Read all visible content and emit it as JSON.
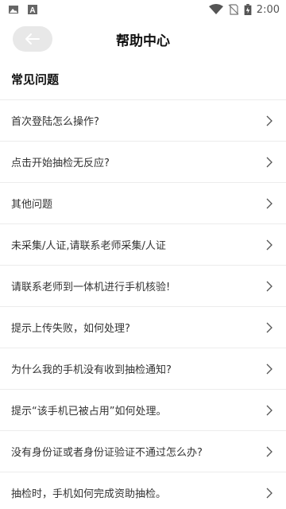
{
  "status_bar": {
    "time": "2:00",
    "left_icons": [
      "image-icon",
      "font-icon"
    ],
    "right_icons": [
      "wifi-icon",
      "no-sim-icon",
      "battery-charging-icon"
    ]
  },
  "header": {
    "title": "帮助中心",
    "back_icon": "arrow-left-icon"
  },
  "faq": {
    "section_title": "常见问题",
    "items": [
      {
        "label": "首次登陆怎么操作?"
      },
      {
        "label": "点击开始抽检无反应?"
      },
      {
        "label": "其他问题"
      },
      {
        "label": "未采集/人证,请联系老师采集/人证"
      },
      {
        "label": "请联系老师到一体机进行手机核验!"
      },
      {
        "label": "提示上传失败，如何处理?"
      },
      {
        "label": "为什么我的手机没有收到抽检通知?"
      },
      {
        "label": "提示“该手机已被占用”如何处理。"
      },
      {
        "label": "没有身份证或者身份证验证不通过怎么办?"
      },
      {
        "label": "抽检时，手机如何完成资助抽检。"
      }
    ]
  },
  "colors": {
    "background": "#ffffff",
    "divider": "#ececec",
    "back_button_bg": "#e8e8e8",
    "chevron": "#555555"
  }
}
